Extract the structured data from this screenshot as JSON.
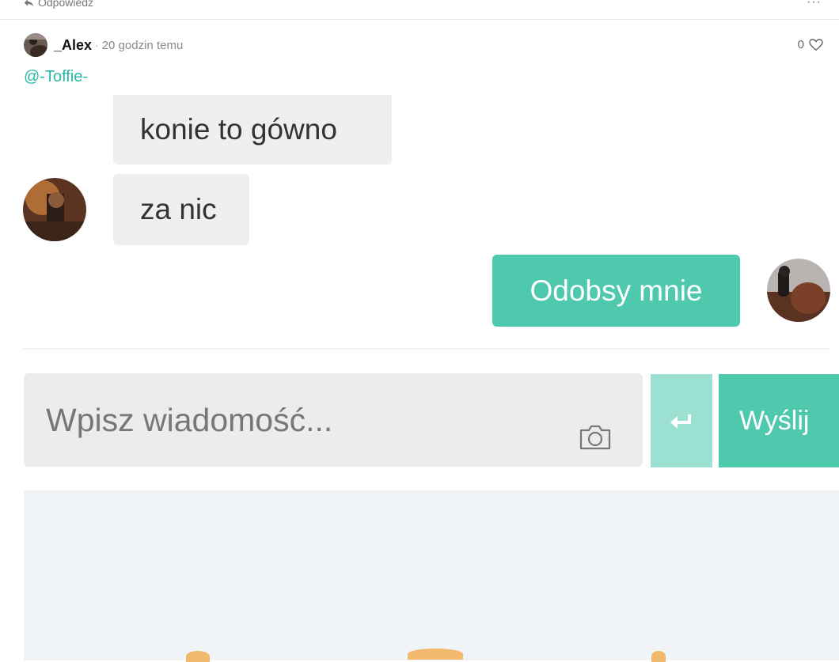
{
  "topbar": {
    "reply_label": "Odpowiedz",
    "more_label": "···"
  },
  "comment": {
    "author": "_Alex",
    "separator": "·",
    "time": "20 godzin temu",
    "likes": "0",
    "mention": "@-Toffie-"
  },
  "chat": {
    "messages": [
      {
        "text": "konie to gówno",
        "side": "left"
      },
      {
        "text": "za nic",
        "side": "left"
      },
      {
        "text": "Odobsy mnie",
        "side": "right"
      }
    ],
    "input_placeholder": "Wpisz wiadomość...",
    "send_label": "Wyślij"
  },
  "colors": {
    "accent": "#4ec9ae",
    "accent_light": "#9be0d0",
    "mention": "#26b8a6"
  }
}
